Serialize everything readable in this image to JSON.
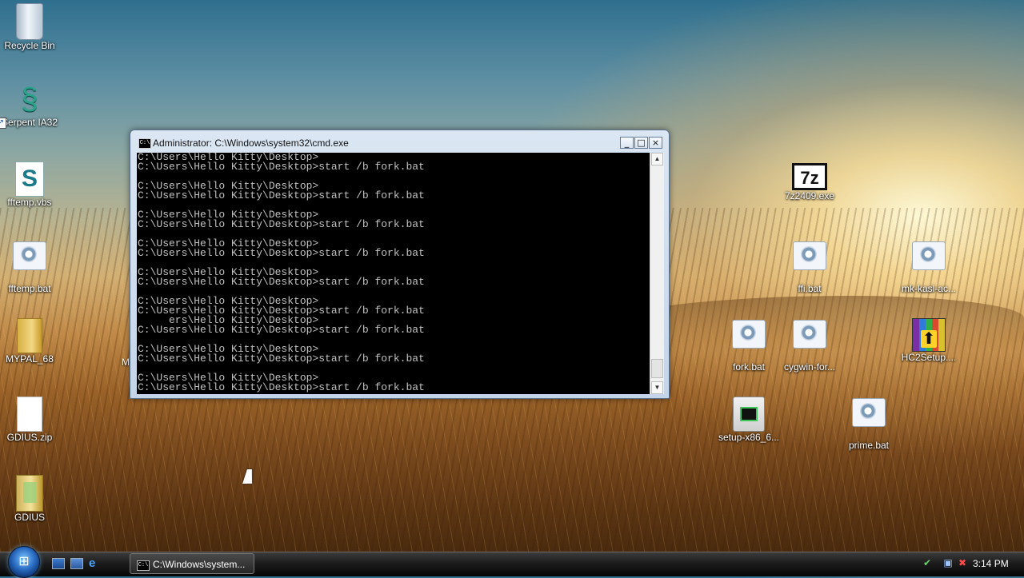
{
  "desktop": {
    "icons": [
      {
        "label": "Recycle Bin",
        "icon": "recycle-bin-icon"
      },
      {
        "label": "Serpent IA32",
        "icon": "serpent-dragon-icon"
      },
      {
        "label": "fftemp.vbs",
        "icon": "vbscript-file-icon"
      },
      {
        "label": "fftemp.bat",
        "icon": "batch-file-icon"
      },
      {
        "label": "MYPAL_68",
        "icon": "folder-icon"
      },
      {
        "label": "GDIUS.zip",
        "icon": "blank-file-icon"
      },
      {
        "label": "GDIUS",
        "icon": "folder-icon"
      },
      {
        "label": "7z2409.exe",
        "icon": "7zip-icon"
      },
      {
        "label": "ffi.bat",
        "icon": "batch-file-icon"
      },
      {
        "label": "mk-kasl-ac...",
        "icon": "batch-file-icon"
      },
      {
        "label": "fork.bat",
        "icon": "batch-file-icon"
      },
      {
        "label": "cygwin-for...",
        "icon": "batch-file-icon"
      },
      {
        "label": "HC2Setup....",
        "icon": "winrar-installer-icon"
      },
      {
        "label": "setup-x86_6...",
        "icon": "cygwin-setup-icon"
      },
      {
        "label": "prime.bat",
        "icon": "batch-file-icon"
      }
    ],
    "partial_label": "M"
  },
  "cmd_window": {
    "title": "Administrator: C:\\Windows\\system32\\cmd.exe",
    "icon_text": "C:\\",
    "minimize": "_",
    "maximize": "□",
    "close": "×",
    "console_lines": [
      "C:\\Users\\Hello Kitty\\Desktop>",
      "C:\\Users\\Hello Kitty\\Desktop>start /b fork.bat",
      "",
      "C:\\Users\\Hello Kitty\\Desktop>",
      "C:\\Users\\Hello Kitty\\Desktop>start /b fork.bat",
      "",
      "C:\\Users\\Hello Kitty\\Desktop>",
      "C:\\Users\\Hello Kitty\\Desktop>start /b fork.bat",
      "",
      "C:\\Users\\Hello Kitty\\Desktop>",
      "C:\\Users\\Hello Kitty\\Desktop>start /b fork.bat",
      "",
      "C:\\Users\\Hello Kitty\\Desktop>",
      "C:\\Users\\Hello Kitty\\Desktop>start /b fork.bat",
      "",
      "C:\\Users\\Hello Kitty\\Desktop>",
      "C:\\Users\\Hello Kitty\\Desktop>start /b fork.bat",
      "     ers\\Hello Kitty\\Desktop>",
      "C:\\Users\\Hello Kitty\\Desktop>start /b fork.bat",
      "",
      "C:\\Users\\Hello Kitty\\Desktop>",
      "C:\\Users\\Hello Kitty\\Desktop>start /b fork.bat",
      "",
      "C:\\Users\\Hello Kitty\\Desktop>",
      "C:\\Users\\Hello Kitty\\Desktop>start /b fork.bat"
    ]
  },
  "taskbar": {
    "start_label": "Start",
    "quick_launch": [
      "show-desktop-icon",
      "switch-windows-icon",
      "internet-explorer-icon"
    ],
    "task_button_label": "C:\\Windows\\system...",
    "task_button_icon_text": "C:\\",
    "tray_icons": [
      "safely-remove-hardware-icon",
      "network-icon",
      "volume-muted-icon"
    ],
    "clock": "3:14 PM"
  },
  "colors": {
    "console_bg": "#000000",
    "console_text": "#c0c0c0",
    "taskbar": "#1c1c1c"
  }
}
